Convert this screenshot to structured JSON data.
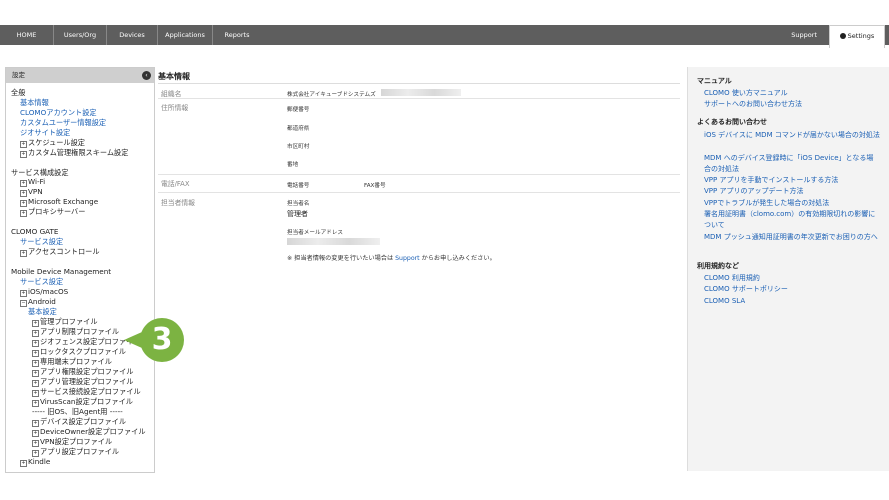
{
  "nav": {
    "tabs": [
      "HOME",
      "Users/Org",
      "Devices",
      "Applications",
      "Reports"
    ],
    "support": "Support",
    "settings": "Settings"
  },
  "sidebar": {
    "header": "設定",
    "toggle_glyph": "‹",
    "general": {
      "title": "全般",
      "items": [
        "基本情報",
        "CLOMOアカウント設定",
        "カスタムユーザー情報設定",
        "ジオサイト設定"
      ],
      "expandables": [
        "スケジュール設定",
        "カスタム管理権限スキーム設定"
      ]
    },
    "service": {
      "title": "サービス構成設定",
      "items": [
        "Wi-Fi",
        "VPN",
        "Microsoft Exchange",
        "プロキシサーバー"
      ]
    },
    "gate": {
      "title": "CLOMO GATE",
      "link": "サービス設定",
      "item": "アクセスコントロール"
    },
    "mdm": {
      "title": "Mobile Device Management",
      "link": "サービス設定",
      "ios": "iOS/macOS",
      "android": "Android",
      "android_basic": "基本設定",
      "profiles": [
        "管理プロファイル",
        "アプリ制限プロファイル",
        "ジオフェンス設定プロファイル",
        "ロックタスクプロファイル",
        "専用端末プロファイル",
        "アプリ権限設定プロファイル",
        "アプリ管理設定プロファイル",
        "サービス接続設定プロファイル",
        "VirusScan設定プロファイル"
      ],
      "separator": "----- 旧OS、旧Agent用 -----",
      "old_profiles": [
        "デバイス設定プロファイル",
        "DeviceOwner設定プロファイル",
        "VPN設定プロファイル",
        "アプリ設定プロファイル"
      ],
      "kindle": "Kindle"
    }
  },
  "main": {
    "title": "基本情報",
    "org_label": "組織名",
    "org_value": "株式会社アイキューブドシステムズ",
    "address_label": "住所情報",
    "postal": "郵便番号",
    "prefecture": "都道府県",
    "city": "市区町村",
    "street": "番地",
    "phone_label": "電話/FAX",
    "phone": "電話番号",
    "fax": "FAX番号",
    "contact_label": "担当者情報",
    "contact_name_label": "担当者名",
    "contact_name": "管理者",
    "contact_email_label": "担当者メールアドレス",
    "notice_prefix": "※ 担当者情報の変更を行いたい場合は",
    "notice_link": "Support",
    "notice_suffix": "からお申し込みください。"
  },
  "right": {
    "manual_title": "マニュアル",
    "manual_links": [
      "CLOMO 使い方マニュアル",
      "サポートへのお問い合わせ方法"
    ],
    "faq_title": "よくあるお問い合わせ",
    "faq_links": [
      "iOS デバイスに MDM コマンドが届かない場合の対処法",
      "MDM へのデバイス登録時に「iOS Device」となる場合の対処法",
      "VPP アプリを手動でインストールする方法",
      "VPP アプリのアップデート方法",
      "VPPでトラブルが発生した場合の対処法",
      "署名用証明書（clomo.com）の有効期限切れの影響について",
      "MDM プッシュ通知用証明書の年次更新でお困りの方へ"
    ],
    "terms_title": "利用規約など",
    "terms_links": [
      "CLOMO 利用規約",
      "CLOMO サポートポリシー",
      "CLOMO SLA"
    ]
  },
  "callout": "3"
}
